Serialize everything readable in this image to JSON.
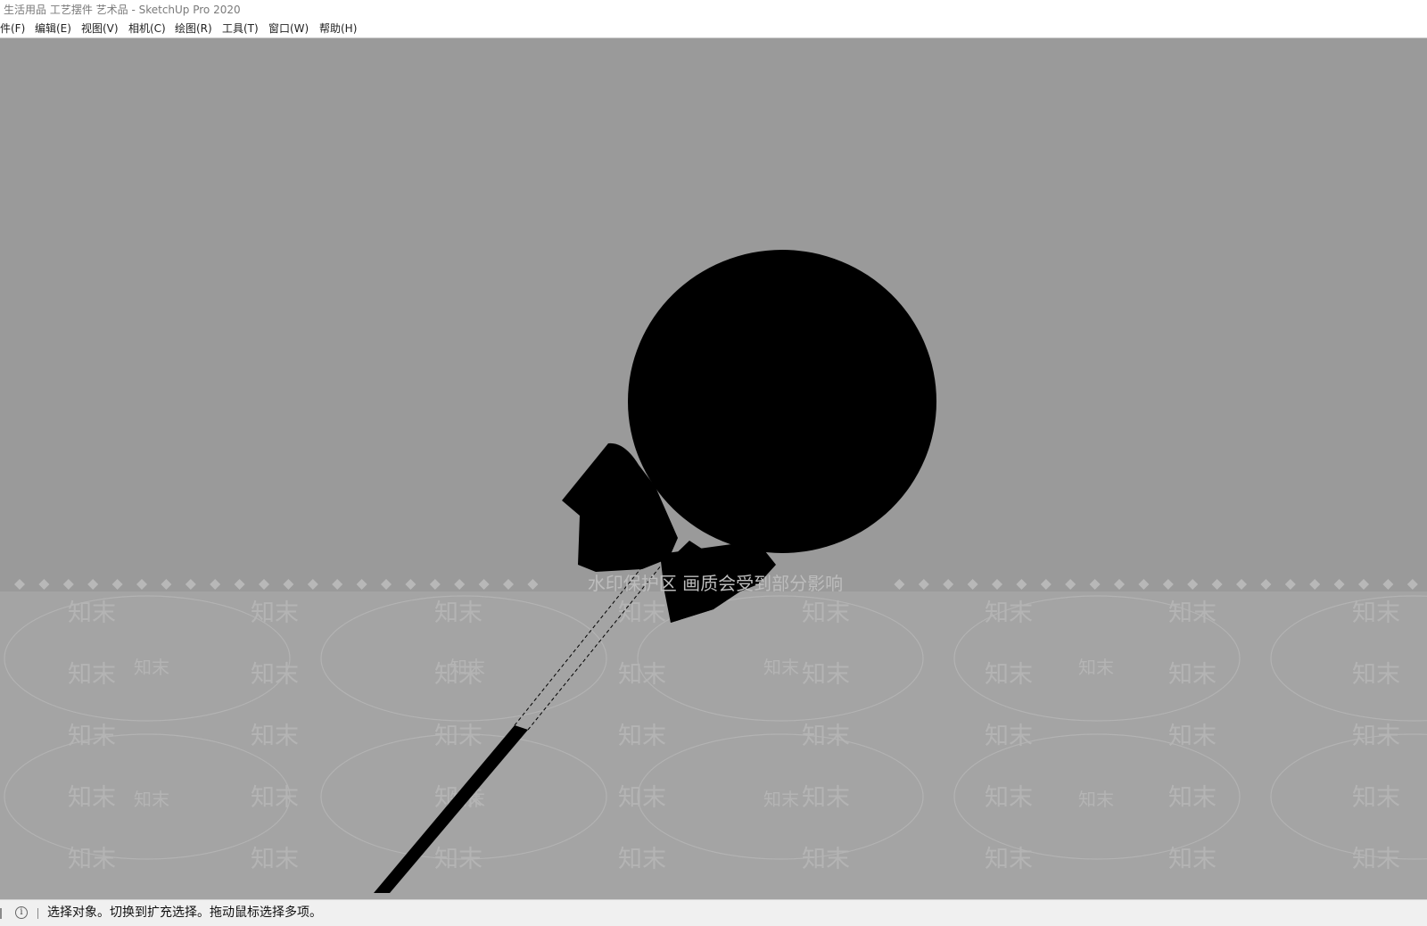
{
  "window": {
    "title": "生活用品 工艺摆件 艺术品 - SketchUp Pro 2020"
  },
  "menu": {
    "items": [
      {
        "label": "件(F)"
      },
      {
        "label": "编辑(E)"
      },
      {
        "label": "视图(V)"
      },
      {
        "label": "相机(C)"
      },
      {
        "label": "绘图(R)"
      },
      {
        "label": "工具(T)"
      },
      {
        "label": "窗口(W)"
      },
      {
        "label": "帮助(H)"
      }
    ]
  },
  "viewport": {
    "background_color": "#9a9a9a",
    "model_color": "#000000",
    "watermark_banner": "水印保护区 画质会受到部分影响",
    "watermark_tile": "知末"
  },
  "status": {
    "info_icon": "info-icon",
    "text": "选择对象。切换到扩充选择。拖动鼠标选择多项。"
  }
}
